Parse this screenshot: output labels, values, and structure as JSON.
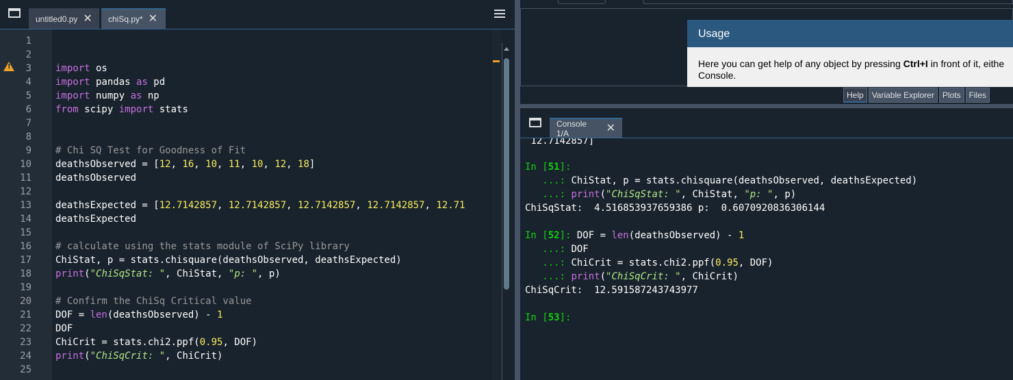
{
  "editor": {
    "tabs": [
      {
        "label": "untitled0.py",
        "close": "✕"
      },
      {
        "label": "chiSq.py*",
        "close": "✕"
      }
    ],
    "line_numbers": [
      "1",
      "2",
      "3",
      "4",
      "5",
      "6",
      "7",
      "8",
      "9",
      "10",
      "11",
      "12",
      "13",
      "14",
      "15",
      "16",
      "17",
      "18",
      "19",
      "20",
      "21",
      "22",
      "23",
      "24",
      "25"
    ],
    "code": {
      "l3_kw": "import",
      "l3_rest": " os",
      "l4_kw": "import",
      "l4_a": " pandas ",
      "l4_kw2": "as",
      "l4_b": " pd",
      "l5_kw": "import",
      "l5_a": " numpy ",
      "l5_kw2": "as",
      "l5_b": " np",
      "l6_kw": "from",
      "l6_a": " scipy ",
      "l6_kw2": "import",
      "l6_b": " stats",
      "l9_comment": "# Chi SQ Test for Goodness of Fit",
      "l10_a": "deathsObserved = [",
      "l10_nums": [
        "12",
        "16",
        "10",
        "11",
        "10",
        "12",
        "18"
      ],
      "l10_end": "]",
      "l11": "deathsObserved",
      "l13_a": "deathsExpected = [",
      "l13_nums": [
        "12.7142857",
        "12.7142857",
        "12.7142857",
        "12.7142857",
        "12.71"
      ],
      "l14": "deathsExpected",
      "l16_comment": "# calculate using the stats module of SciPy library",
      "l17": "ChiStat, p = stats.chisquare(deathsObserved, deathsExpected)",
      "l18_fn": "print",
      "l18_a": "(",
      "l18_s1": "\"ChiSqStat: \"",
      "l18_b": ", ChiStat, ",
      "l18_s2": "\"p: \"",
      "l18_c": ", p)",
      "l20_comment": "# Confirm the ChiSq Critical value",
      "l21_a": "DOF = ",
      "l21_fn": "len",
      "l21_b": "(deathsObserved) - ",
      "l21_num": "1",
      "l22": "DOF",
      "l23_a": "ChiCrit = stats.chi2.ppf(",
      "l23_num": "0.95",
      "l23_b": ", DOF)",
      "l24_fn": "print",
      "l24_a": "(",
      "l24_s": "\"ChiSqCrit: \"",
      "l24_b": ", ChiCrit)"
    }
  },
  "help": {
    "usage_title": "Usage",
    "usage_text_1": "Here you can get help of any object by pressing ",
    "usage_text_bold": "Ctrl+I",
    "usage_text_2": " in front of it, eithe",
    "usage_text_3": "Console.",
    "tabs": [
      "Help",
      "Variable Explorer",
      "Plots",
      "Files"
    ]
  },
  "console": {
    "tab_label": "Console 1/A",
    "tab_close": "✕",
    "top_fragment": " 12.7142857]",
    "in": "In [",
    "close_bracket": "]:",
    "cont": "   ...: ",
    "b51_num": "51",
    "b51_l1": "ChiStat, p = stats.chisquare(deathsObserved, deathsExpected)",
    "b51_l2_fn": "print",
    "b51_l2_a": "(",
    "b51_l2_s1": "\"ChiSqStat: \"",
    "b51_l2_b": ", ChiStat, ",
    "b51_l2_s2": "\"p: \"",
    "b51_l2_c": ", p)",
    "out51": "ChiSqStat:  4.516853937659386 p:  0.6070920836306144",
    "b52_num": "52",
    "b52_l1_a": "DOF = ",
    "b52_l1_fn": "len",
    "b52_l1_b": "(deathsObserved) - ",
    "b52_l1_num": "1",
    "b52_l2": "DOF",
    "b52_l3_a": "ChiCrit = stats.chi2.ppf(",
    "b52_l3_num": "0.95",
    "b52_l3_b": ", DOF)",
    "b52_l4_fn": "print",
    "b52_l4_a": "(",
    "b52_l4_s": "\"ChiSqCrit: \"",
    "b52_l4_b": ", ChiCrit)",
    "out52": "ChiSqCrit:  12.591587243743977",
    "b53_num": "53"
  }
}
